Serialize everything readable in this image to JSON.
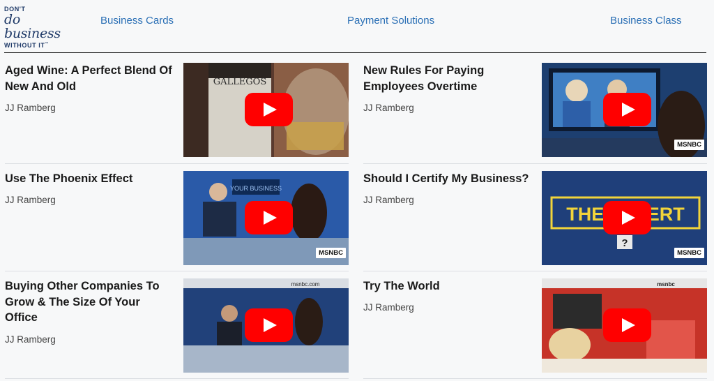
{
  "logo": {
    "line1": "DON'T",
    "line2": "do business",
    "line3": "WITHOUT IT"
  },
  "nav": {
    "items": [
      "Business Cards",
      "Payment Solutions",
      "Business Class"
    ]
  },
  "videos": [
    {
      "title": "Aged Wine: A Perfect Blend Of New And Old",
      "author": "JJ Ramberg",
      "thumb_text": "GALLEGOS",
      "badge": ""
    },
    {
      "title": "New Rules For Paying Employees Overtime",
      "author": "JJ Ramberg",
      "thumb_text": "",
      "badge": "MSNBC"
    },
    {
      "title": "Use The Phoenix Effect",
      "author": "JJ Ramberg",
      "thumb_text": "YOUR BUSINESS",
      "badge": "MSNBC"
    },
    {
      "title": "Should I Certify My Business?",
      "author": "JJ Ramberg",
      "thumb_text": "THE EXPERT",
      "badge": "MSNBC"
    },
    {
      "title": "Buying Other Companies To Grow & The Size Of Your Office",
      "author": "JJ Ramberg",
      "thumb_text": "msnbc.com",
      "badge": ""
    },
    {
      "title": "Try The World",
      "author": "JJ Ramberg",
      "thumb_text": "msnbc",
      "badge": ""
    }
  ],
  "colors": {
    "nav_link": "#2a6fb5",
    "logo": "#1f3a68",
    "play_button": "#ff0000"
  }
}
